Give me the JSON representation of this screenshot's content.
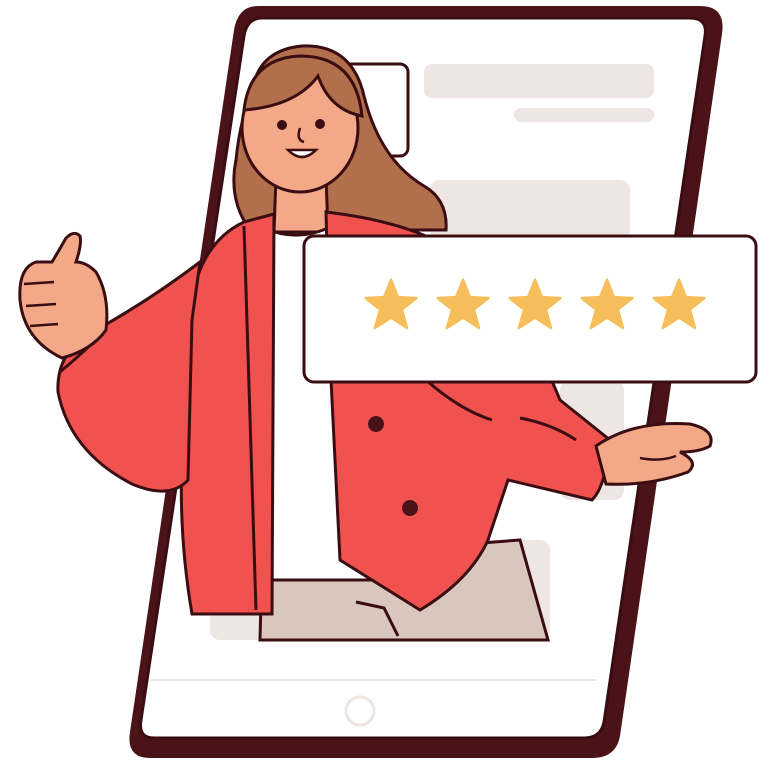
{
  "illustration": {
    "subject": "woman",
    "device": "tablet"
  },
  "rating": {
    "stars_filled": 5,
    "stars_total": 5,
    "star_icon": "star-icon"
  },
  "colors": {
    "device_frame": "#4a1318",
    "screen": "#ffffff",
    "placeholder_block": "#ede6e3",
    "jacket": "#f0534f",
    "skin": "#f3a887",
    "hair": "#b26f4c",
    "star": "#f7bf5c",
    "outline": "#3a0d12",
    "pants": "#d9c7bd"
  }
}
